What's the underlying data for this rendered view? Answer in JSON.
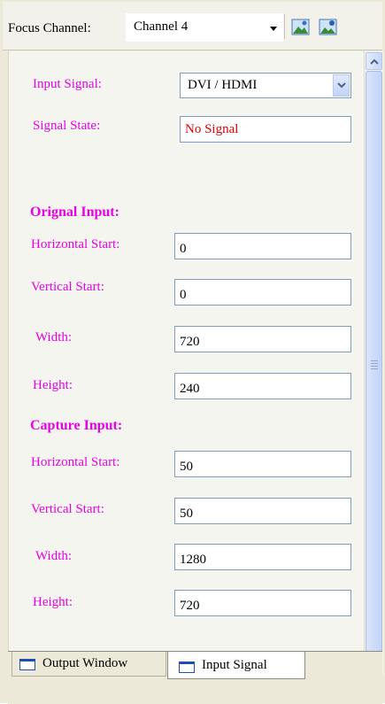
{
  "toolbar": {
    "focus_label": "Focus Channel:",
    "channel_value": "Channel 4",
    "buttons": [
      {
        "icon": "image-icon"
      },
      {
        "icon": "image-user-icon"
      }
    ]
  },
  "input_signal": {
    "label": "Input Signal:",
    "selected": "DVI / HDMI"
  },
  "signal_state": {
    "label": "Signal State:",
    "value": "No Signal",
    "color": "#e00000"
  },
  "original_input": {
    "heading": "Orignal Input:",
    "horizontal_start": {
      "label": "Horizontal Start:",
      "value": "0"
    },
    "vertical_start": {
      "label": "Vertical Start:",
      "value": "0"
    },
    "width": {
      "label": "Width:",
      "value": "720"
    },
    "height": {
      "label": "Height:",
      "value": "240"
    }
  },
  "capture_input": {
    "heading": "Capture Input:",
    "horizontal_start": {
      "label": "Horizontal Start:",
      "value": "50"
    },
    "vertical_start": {
      "label": "Vertical Start:",
      "value": "50"
    },
    "width": {
      "label": "Width:",
      "value": "1280"
    },
    "height": {
      "label": "Height:",
      "value": "720"
    }
  },
  "tabs": [
    {
      "label": "Output Window",
      "active": false
    },
    {
      "label": "Input Signal",
      "active": true
    }
  ],
  "colors": {
    "label_magenta": "#e800e8",
    "accent_blue": "#1b4fb3"
  }
}
